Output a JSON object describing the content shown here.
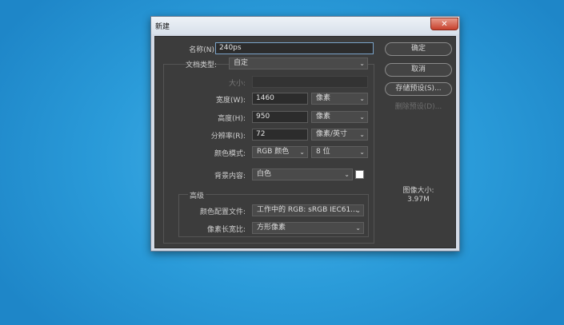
{
  "dialog": {
    "title": "新建",
    "close_glyph": "✕",
    "name": {
      "label": "名称(N):",
      "value": "240ps"
    },
    "preset": {
      "label": "文档类型:",
      "value": "自定"
    },
    "size": {
      "label": "大小:",
      "value": ""
    },
    "width": {
      "label": "宽度(W):",
      "value": "1460",
      "unit": "像素"
    },
    "height": {
      "label": "高度(H):",
      "value": "950",
      "unit": "像素"
    },
    "resolution": {
      "label": "分辨率(R):",
      "value": "72",
      "unit": "像素/英寸"
    },
    "color_mode": {
      "label": "颜色模式:",
      "mode": "RGB 颜色",
      "depth": "8 位"
    },
    "background": {
      "label": "背景内容:",
      "value": "白色",
      "swatch_color": "#ffffff"
    },
    "advanced": {
      "title": "高级",
      "color_profile": {
        "label": "颜色配置文件:",
        "value": "工作中的 RGB: sRGB IEC61..."
      },
      "pixel_aspect": {
        "label": "像素长宽比:",
        "value": "方形像素"
      }
    },
    "buttons": {
      "ok": "确定",
      "cancel": "取消",
      "save_preset": "存储预设(S)...",
      "delete_preset": "删除预设(D)..."
    },
    "image_size": {
      "label": "图像大小:",
      "value": "3.97M"
    }
  },
  "icons": {
    "chevron": "chevron-down-icon",
    "close": "close-icon"
  }
}
